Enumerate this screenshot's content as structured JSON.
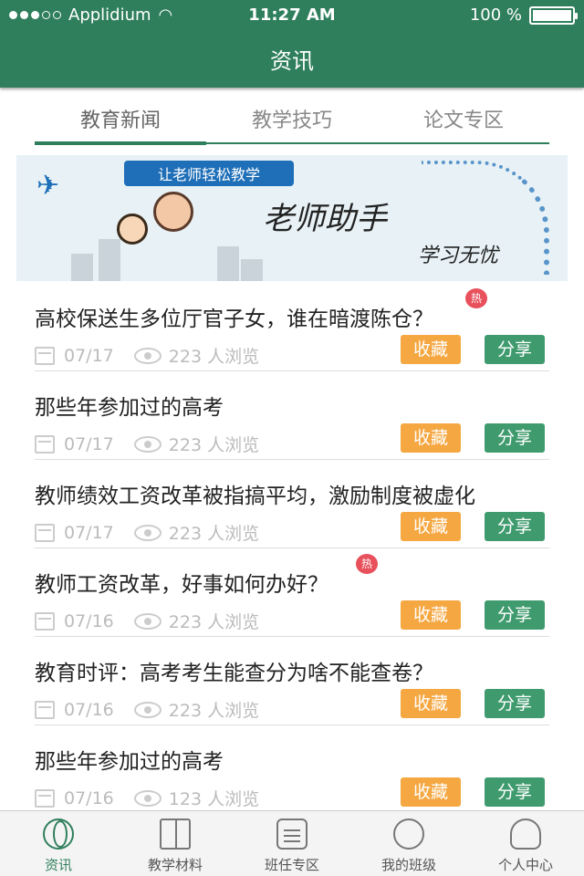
{
  "status_bar": {
    "carrier": "Applidium",
    "time": "11:27 AM",
    "battery": "100 %"
  },
  "nav": {
    "title": "资讯"
  },
  "tabs": [
    {
      "label": "教育新闻"
    },
    {
      "label": "教学技巧"
    },
    {
      "label": "论文专区"
    }
  ],
  "banner": {
    "ribbon": "让老师轻松教学",
    "title": "老师助手",
    "subtitle": "学习无忧"
  },
  "articles": [
    {
      "title": "高校保送生多位厅官子女，谁在暗渡陈仓？",
      "hot": true,
      "date": "07/17",
      "views": "223 人浏览",
      "fav": "收藏",
      "share": "分享"
    },
    {
      "title": "那些年参加过的高考",
      "hot": false,
      "date": "07/17",
      "views": "223 人浏览",
      "fav": "收藏",
      "share": "分享"
    },
    {
      "title": "教师绩效工资改革被指搞平均，激励制度被虚化",
      "hot": false,
      "date": "07/17",
      "views": "223 人浏览",
      "fav": "收藏",
      "share": "分享"
    },
    {
      "title": "教师工资改革，好事如何办好？",
      "hot": true,
      "date": "07/16",
      "views": "223 人浏览",
      "fav": "收藏",
      "share": "分享"
    },
    {
      "title": "教育时评：高考考生能查分为啥不能查卷？",
      "hot": false,
      "date": "07/16",
      "views": "223 人浏览",
      "fav": "收藏",
      "share": "分享"
    },
    {
      "title": "那些年参加过的高考",
      "hot": false,
      "date": "07/16",
      "views": "123 人浏览",
      "fav": "收藏",
      "share": "分享"
    }
  ],
  "hot_badge": "热",
  "tabbar": [
    {
      "label": "资讯",
      "icon": "globe-icon"
    },
    {
      "label": "教学材料",
      "icon": "book-icon"
    },
    {
      "label": "班任专区",
      "icon": "document-icon"
    },
    {
      "label": "我的班级",
      "icon": "medal-icon"
    },
    {
      "label": "个人中心",
      "icon": "user-icon"
    }
  ],
  "colors": {
    "primary": "#2f7f5c",
    "favorite": "#f5a741",
    "share": "#3f9b6e",
    "hot": "#e8505b"
  }
}
